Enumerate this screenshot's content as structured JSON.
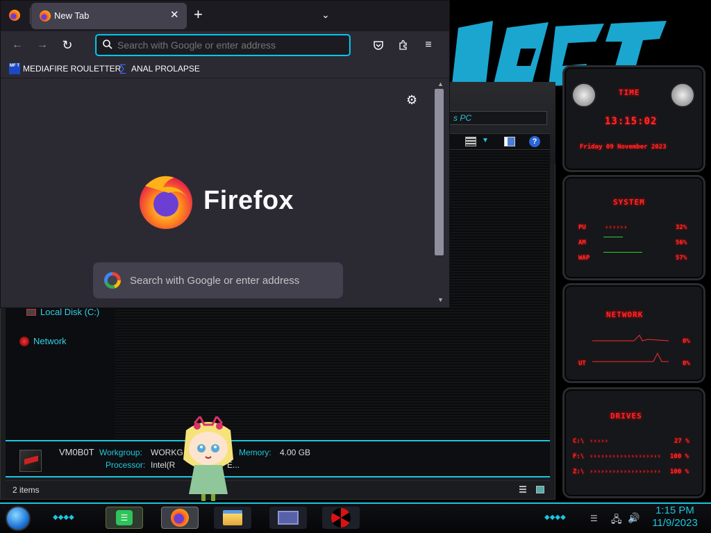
{
  "firefox": {
    "tab_title": "New Tab",
    "url_placeholder": "Search with Google or enter address",
    "bookmarks": [
      {
        "label": "MEDIAFIRE ROULETTER",
        "icon": "mediafire-icon"
      },
      {
        "label": "ANAL PROLAPSE",
        "icon": "bookmark-sigma-icon"
      }
    ],
    "brand_name": "Firefox",
    "search_placeholder": "Search with Google or enter address",
    "colors": {
      "accent": "#00ddff",
      "bg": "#2b2a33",
      "tab_active": "#42414d"
    }
  },
  "explorer": {
    "address_text": "s PC",
    "nav_items": [
      {
        "label": "Local Disk (C:)",
        "icon": "drive-icon"
      },
      {
        "label": "Network",
        "icon": "network-icon"
      }
    ],
    "computer_name": "VM0B0T",
    "workgroup_label": "Workgroup:",
    "workgroup_value": "WORKG",
    "memory_label": "Memory:",
    "memory_value": "4.00 GB",
    "processor_label": "Processor:",
    "processor_value": "Intel(R",
    "processor_tail": "E...",
    "status_items": "2 items"
  },
  "gadgets": {
    "time": {
      "title": "TIME",
      "clock": "13:15:02",
      "date": "Friday 09 November 2023"
    },
    "system": {
      "title": "SYSTEM",
      "rows": [
        {
          "label": "PU",
          "value": "32%"
        },
        {
          "label": "AM",
          "value": "56%"
        },
        {
          "label": "WAP",
          "value": "57%"
        }
      ]
    },
    "network": {
      "title": "NETWORK",
      "rows": [
        {
          "label": "",
          "value": "0%"
        },
        {
          "label": "UT",
          "value": "0%"
        }
      ]
    },
    "drives": {
      "title": "DRIVES",
      "rows": [
        {
          "label": "C:\\",
          "value": "27 %"
        },
        {
          "label": "F:\\",
          "value": "100 %"
        },
        {
          "label": "Z:\\",
          "value": "100 %"
        }
      ]
    },
    "color": "#ff2626"
  },
  "taskbar": {
    "time": "1:15 PM",
    "date": "11/9/2023",
    "apps": [
      {
        "name": "notes-app-icon"
      },
      {
        "name": "firefox-icon"
      },
      {
        "name": "file-explorer-icon"
      },
      {
        "name": "window-app-icon"
      },
      {
        "name": "radiation-icon"
      }
    ]
  }
}
